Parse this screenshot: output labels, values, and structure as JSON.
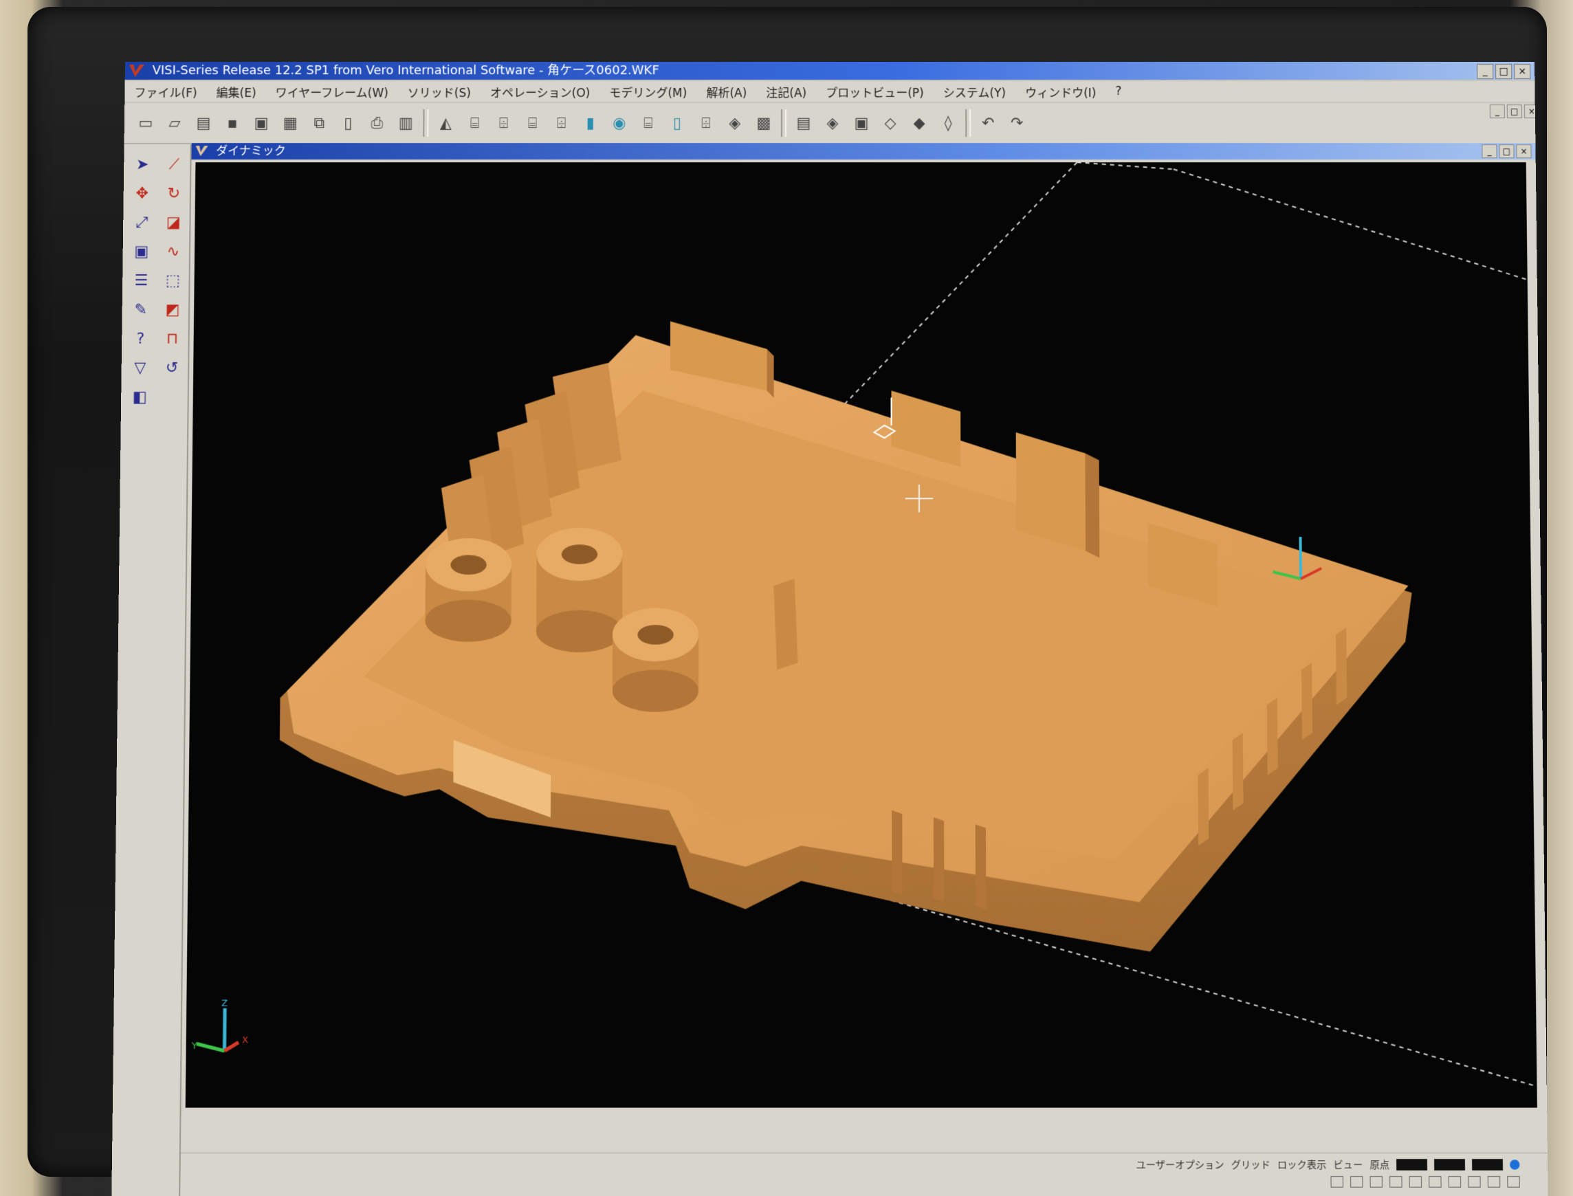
{
  "window": {
    "title": "VISI-Series Release 12.2 SP1 from Vero International Software - 角ケース0602.WKF",
    "controls": [
      "_",
      "□",
      "×"
    ]
  },
  "menu": [
    "ファイル(F)",
    "編集(E)",
    "ワイヤーフレーム(W)",
    "ソリッド(S)",
    "オペレーション(O)",
    "モデリング(M)",
    "解析(A)",
    "注記(A)",
    "プロットビュー(P)",
    "システム(Y)",
    "ウィンドウ(I)",
    "?"
  ],
  "toolbar": {
    "icons": [
      "new-file-icon",
      "open-file-icon",
      "open-folder-icon",
      "save-icon",
      "save-all-icon",
      "print-icon",
      "copy-icon",
      "paste-icon",
      "print-setup-icon",
      "layers-icon",
      "sep",
      "shade-icon",
      "cylinder-1-icon",
      "cylinder-2-icon",
      "cylinder-3-icon",
      "cylinder-4-icon",
      "cylinder-5-icon",
      "cylinder-6-icon",
      "cylinder-7-icon",
      "cylinder-8-icon",
      "cylinder-9-icon",
      "cylinder-10-icon",
      "cylinder-11-icon",
      "sep",
      "view-1-icon",
      "view-2-icon",
      "view-3-icon",
      "view-4-icon",
      "view-5-icon",
      "view-6-icon",
      "sep",
      "undo-icon",
      "redo-icon"
    ]
  },
  "left_tools": [
    "select-icon",
    "measure-icon",
    "move-icon",
    "rotate-icon",
    "scale-icon",
    "edit-icon",
    "view-icon",
    "curve-icon",
    "list-icon",
    "box-icon",
    "paint-icon",
    "delete-icon",
    "query-icon",
    "bracket-icon",
    "filter-icon",
    "revert-icon",
    "properties-icon"
  ],
  "child_window": {
    "title": "ダイナミック",
    "controls": [
      "_",
      "□",
      "×"
    ]
  },
  "axis_labels": {
    "x": "X",
    "y": "Y",
    "z": "Z"
  },
  "colors": {
    "model": "#e0a35e",
    "viewport_bg": "#050505",
    "title_bar": "#1a3fa8"
  },
  "status": {
    "row1": [
      "ユーザーオプション",
      "グリッド",
      "ロック表示",
      "ビュー",
      "原点"
    ],
    "row2": [
      "□",
      "□",
      "□",
      "□",
      "□",
      "□",
      "□",
      "□",
      "□",
      "□"
    ]
  }
}
